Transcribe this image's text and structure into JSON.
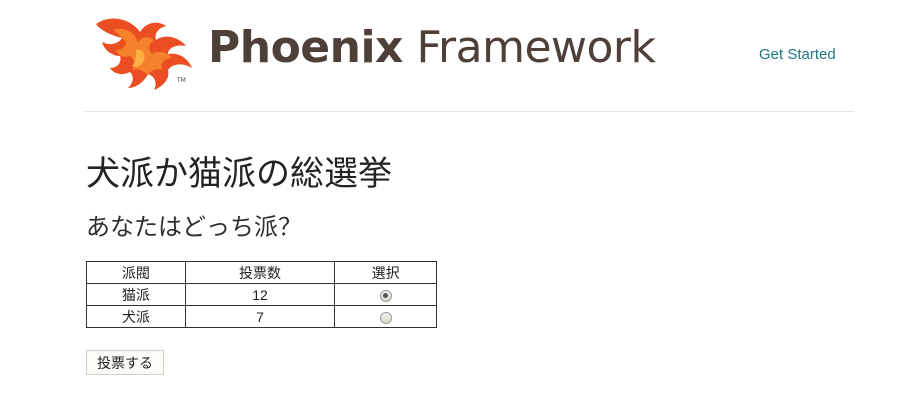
{
  "header": {
    "logo_text_bold": "Phoenix",
    "logo_text_light": "Framework",
    "nav_link": "Get Started",
    "logo_colors": {
      "flame_dark": "#ec4e23",
      "flame_light": "#f5822a",
      "wordmark": "#4e3f38"
    }
  },
  "page": {
    "title": "犬派か猫派の総選挙",
    "question": "あなたはどっち派？"
  },
  "table": {
    "headers": [
      "派閥",
      "投票数",
      "選択"
    ],
    "rows": [
      {
        "faction": "猫派",
        "votes": "12",
        "selected": true
      },
      {
        "faction": "犬派",
        "votes": "7",
        "selected": false
      }
    ]
  },
  "form": {
    "submit_label": "投票する"
  },
  "colors": {
    "link": "#207783",
    "divider": "#e6e6e0"
  }
}
